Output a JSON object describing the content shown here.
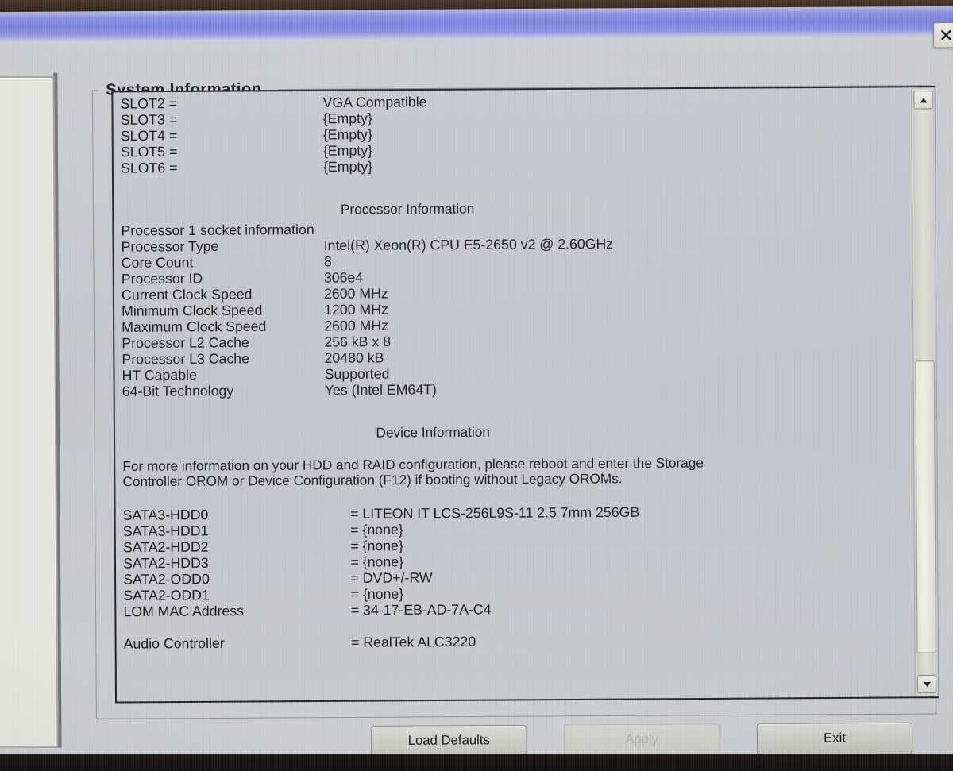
{
  "window": {
    "close_icon": "close-icon"
  },
  "groupbox": {
    "title": "System Information"
  },
  "slots": {
    "rows": [
      {
        "label": "SLOT2 =",
        "value": "VGA Compatible"
      },
      {
        "label": "SLOT3 =",
        "value": "{Empty}"
      },
      {
        "label": "SLOT4 =",
        "value": "{Empty}"
      },
      {
        "label": "SLOT5 =",
        "value": "{Empty}"
      },
      {
        "label": "SLOT6 =",
        "value": "{Empty}"
      }
    ]
  },
  "processor": {
    "heading": "Processor Information",
    "socket_line": "Processor 1 socket information",
    "rows": [
      {
        "label": "Processor Type",
        "value": "Intel(R) Xeon(R) CPU E5-2650 v2 @ 2.60GHz"
      },
      {
        "label": "Core Count",
        "value": "8"
      },
      {
        "label": "Processor ID",
        "value": "306e4"
      },
      {
        "label": "Current Clock Speed",
        "value": "2600 MHz"
      },
      {
        "label": "Minimum Clock Speed",
        "value": "1200 MHz"
      },
      {
        "label": "Maximum Clock Speed",
        "value": "2600 MHz"
      },
      {
        "label": "Processor L2 Cache",
        "value": "256 kB x 8"
      },
      {
        "label": "Processor L3 Cache",
        "value": "20480 kB"
      },
      {
        "label": "HT Capable",
        "value": "Supported"
      },
      {
        "label": "64-Bit Technology",
        "value": "Yes (Intel EM64T)"
      }
    ]
  },
  "device": {
    "heading": "Device Information",
    "note_line1": "For more information on your HDD and RAID configuration, please reboot and enter the Storage",
    "note_line2": "Controller OROM or Device Configuration (F12) if booting without Legacy OROMs.",
    "rows": [
      {
        "label": "SATA3-HDD0",
        "value": "= LITEON IT LCS-256L9S-11 2.5 7mm 256GB"
      },
      {
        "label": "SATA3-HDD1",
        "value": "= {none}"
      },
      {
        "label": "SATA2-HDD2",
        "value": "= {none}"
      },
      {
        "label": "SATA2-HDD3",
        "value": "= {none}"
      },
      {
        "label": "SATA2-ODD0",
        "value": "= DVD+/-RW"
      },
      {
        "label": "SATA2-ODD1",
        "value": "= {none}"
      },
      {
        "label": "LOM MAC Address",
        "value": "= 34-17-EB-AD-7A-C4"
      }
    ],
    "audio": {
      "label": "Audio Controller",
      "value": "= RealTek ALC3220"
    }
  },
  "scrollbar": {
    "up_icon": "scroll-up-arrow-icon",
    "down_icon": "scroll-down-arrow-icon"
  },
  "buttons": {
    "load_defaults": "Load Defaults",
    "apply": "Apply",
    "exit": "Exit"
  },
  "colors": {
    "titlebar_accent": "#7f84e0",
    "dialog_bg": "#c9ccd2",
    "panel_bg": "#c5c9cf",
    "text": "#15161a",
    "disabled_text": "#b5b5ae",
    "bezel": "#3a2d24"
  }
}
